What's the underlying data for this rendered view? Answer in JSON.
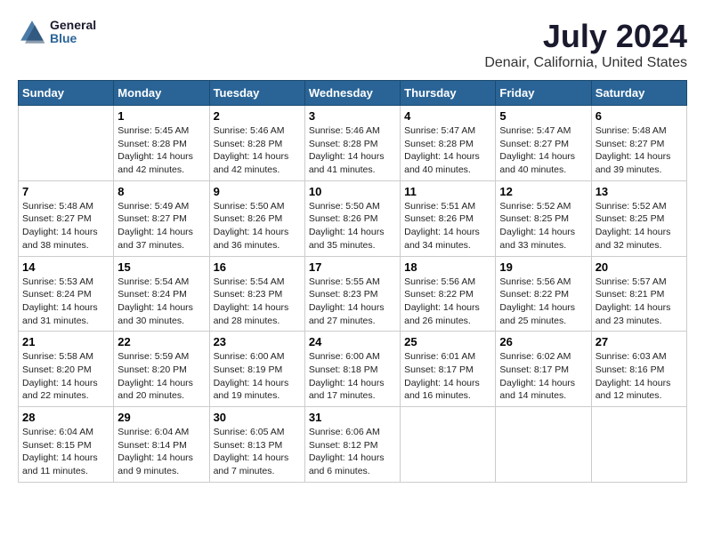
{
  "logo": {
    "text1": "General",
    "text2": "Blue"
  },
  "title": "July 2024",
  "subtitle": "Denair, California, United States",
  "days_of_week": [
    "Sunday",
    "Monday",
    "Tuesday",
    "Wednesday",
    "Thursday",
    "Friday",
    "Saturday"
  ],
  "weeks": [
    [
      {
        "day": "",
        "info": ""
      },
      {
        "day": "1",
        "info": "Sunrise: 5:45 AM\nSunset: 8:28 PM\nDaylight: 14 hours\nand 42 minutes."
      },
      {
        "day": "2",
        "info": "Sunrise: 5:46 AM\nSunset: 8:28 PM\nDaylight: 14 hours\nand 42 minutes."
      },
      {
        "day": "3",
        "info": "Sunrise: 5:46 AM\nSunset: 8:28 PM\nDaylight: 14 hours\nand 41 minutes."
      },
      {
        "day": "4",
        "info": "Sunrise: 5:47 AM\nSunset: 8:28 PM\nDaylight: 14 hours\nand 40 minutes."
      },
      {
        "day": "5",
        "info": "Sunrise: 5:47 AM\nSunset: 8:27 PM\nDaylight: 14 hours\nand 40 minutes."
      },
      {
        "day": "6",
        "info": "Sunrise: 5:48 AM\nSunset: 8:27 PM\nDaylight: 14 hours\nand 39 minutes."
      }
    ],
    [
      {
        "day": "7",
        "info": "Sunrise: 5:48 AM\nSunset: 8:27 PM\nDaylight: 14 hours\nand 38 minutes."
      },
      {
        "day": "8",
        "info": "Sunrise: 5:49 AM\nSunset: 8:27 PM\nDaylight: 14 hours\nand 37 minutes."
      },
      {
        "day": "9",
        "info": "Sunrise: 5:50 AM\nSunset: 8:26 PM\nDaylight: 14 hours\nand 36 minutes."
      },
      {
        "day": "10",
        "info": "Sunrise: 5:50 AM\nSunset: 8:26 PM\nDaylight: 14 hours\nand 35 minutes."
      },
      {
        "day": "11",
        "info": "Sunrise: 5:51 AM\nSunset: 8:26 PM\nDaylight: 14 hours\nand 34 minutes."
      },
      {
        "day": "12",
        "info": "Sunrise: 5:52 AM\nSunset: 8:25 PM\nDaylight: 14 hours\nand 33 minutes."
      },
      {
        "day": "13",
        "info": "Sunrise: 5:52 AM\nSunset: 8:25 PM\nDaylight: 14 hours\nand 32 minutes."
      }
    ],
    [
      {
        "day": "14",
        "info": "Sunrise: 5:53 AM\nSunset: 8:24 PM\nDaylight: 14 hours\nand 31 minutes."
      },
      {
        "day": "15",
        "info": "Sunrise: 5:54 AM\nSunset: 8:24 PM\nDaylight: 14 hours\nand 30 minutes."
      },
      {
        "day": "16",
        "info": "Sunrise: 5:54 AM\nSunset: 8:23 PM\nDaylight: 14 hours\nand 28 minutes."
      },
      {
        "day": "17",
        "info": "Sunrise: 5:55 AM\nSunset: 8:23 PM\nDaylight: 14 hours\nand 27 minutes."
      },
      {
        "day": "18",
        "info": "Sunrise: 5:56 AM\nSunset: 8:22 PM\nDaylight: 14 hours\nand 26 minutes."
      },
      {
        "day": "19",
        "info": "Sunrise: 5:56 AM\nSunset: 8:22 PM\nDaylight: 14 hours\nand 25 minutes."
      },
      {
        "day": "20",
        "info": "Sunrise: 5:57 AM\nSunset: 8:21 PM\nDaylight: 14 hours\nand 23 minutes."
      }
    ],
    [
      {
        "day": "21",
        "info": "Sunrise: 5:58 AM\nSunset: 8:20 PM\nDaylight: 14 hours\nand 22 minutes."
      },
      {
        "day": "22",
        "info": "Sunrise: 5:59 AM\nSunset: 8:20 PM\nDaylight: 14 hours\nand 20 minutes."
      },
      {
        "day": "23",
        "info": "Sunrise: 6:00 AM\nSunset: 8:19 PM\nDaylight: 14 hours\nand 19 minutes."
      },
      {
        "day": "24",
        "info": "Sunrise: 6:00 AM\nSunset: 8:18 PM\nDaylight: 14 hours\nand 17 minutes."
      },
      {
        "day": "25",
        "info": "Sunrise: 6:01 AM\nSunset: 8:17 PM\nDaylight: 14 hours\nand 16 minutes."
      },
      {
        "day": "26",
        "info": "Sunrise: 6:02 AM\nSunset: 8:17 PM\nDaylight: 14 hours\nand 14 minutes."
      },
      {
        "day": "27",
        "info": "Sunrise: 6:03 AM\nSunset: 8:16 PM\nDaylight: 14 hours\nand 12 minutes."
      }
    ],
    [
      {
        "day": "28",
        "info": "Sunrise: 6:04 AM\nSunset: 8:15 PM\nDaylight: 14 hours\nand 11 minutes."
      },
      {
        "day": "29",
        "info": "Sunrise: 6:04 AM\nSunset: 8:14 PM\nDaylight: 14 hours\nand 9 minutes."
      },
      {
        "day": "30",
        "info": "Sunrise: 6:05 AM\nSunset: 8:13 PM\nDaylight: 14 hours\nand 7 minutes."
      },
      {
        "day": "31",
        "info": "Sunrise: 6:06 AM\nSunset: 8:12 PM\nDaylight: 14 hours\nand 6 minutes."
      },
      {
        "day": "",
        "info": ""
      },
      {
        "day": "",
        "info": ""
      },
      {
        "day": "",
        "info": ""
      }
    ]
  ]
}
